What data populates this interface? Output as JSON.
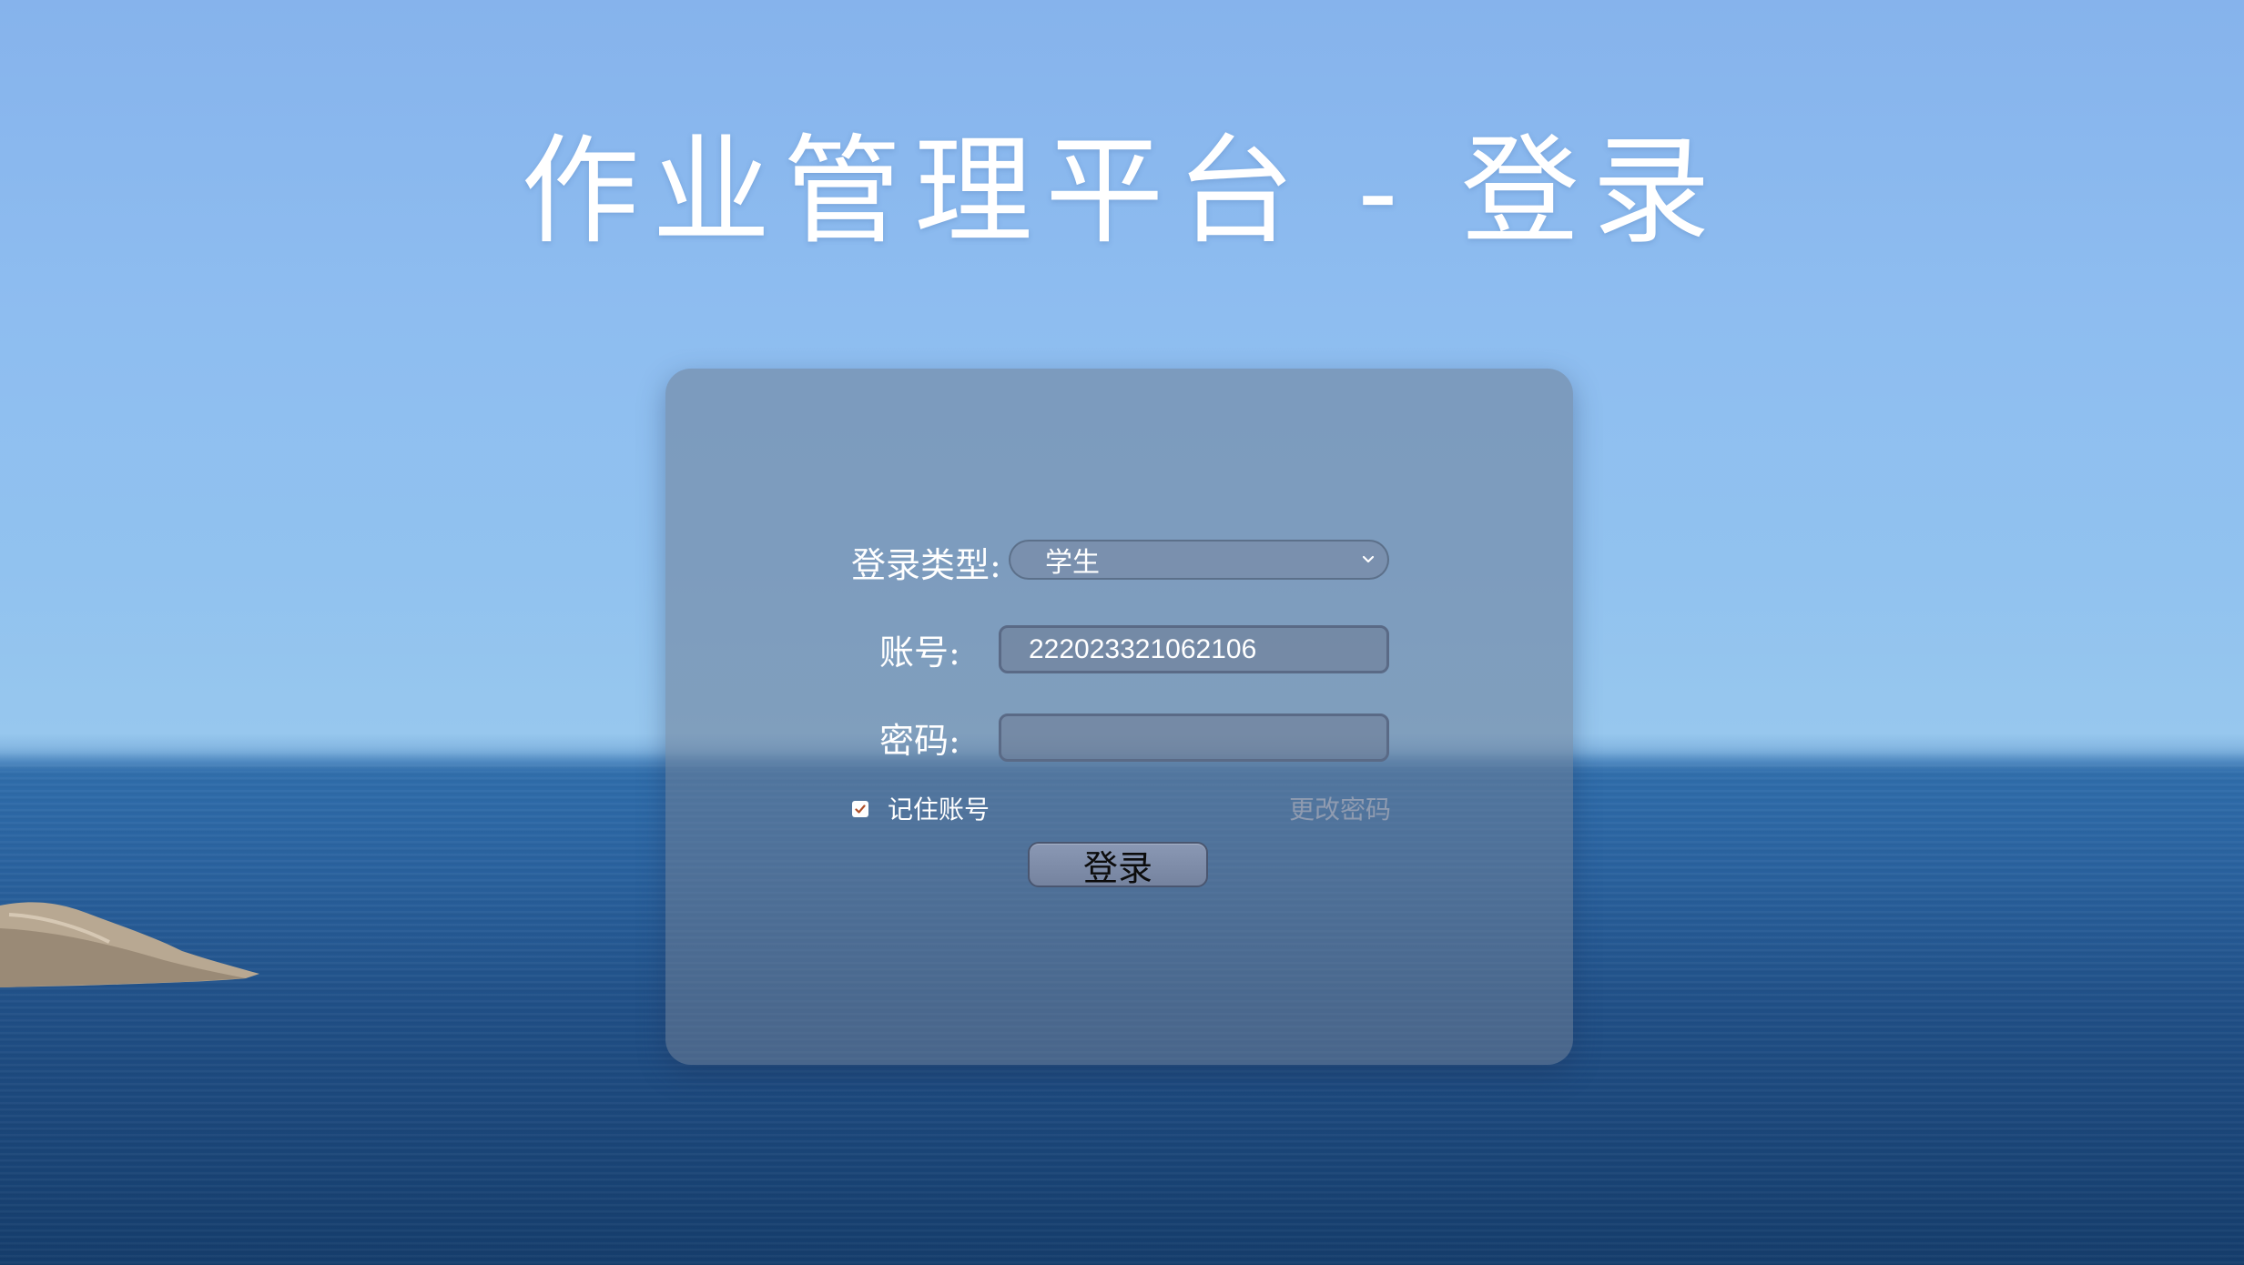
{
  "header": {
    "title": "作业管理平台 - 登录"
  },
  "form": {
    "login_type_label": "登录类型:",
    "login_type_value": "学生",
    "account_label": "账号:",
    "account_value": "222023321062106",
    "password_label": "密码:",
    "password_value": "",
    "remember_label": "记住账号",
    "remember_checked": true,
    "change_password_label": "更改密码",
    "login_button_label": "登录"
  },
  "icons": {
    "select_arrow": "chevron-down-icon",
    "checkbox_mark": "check-icon"
  },
  "colors": {
    "card_background": "#6e7d96",
    "title_text": "#ffffff",
    "link_muted": "#8f9bb0"
  }
}
